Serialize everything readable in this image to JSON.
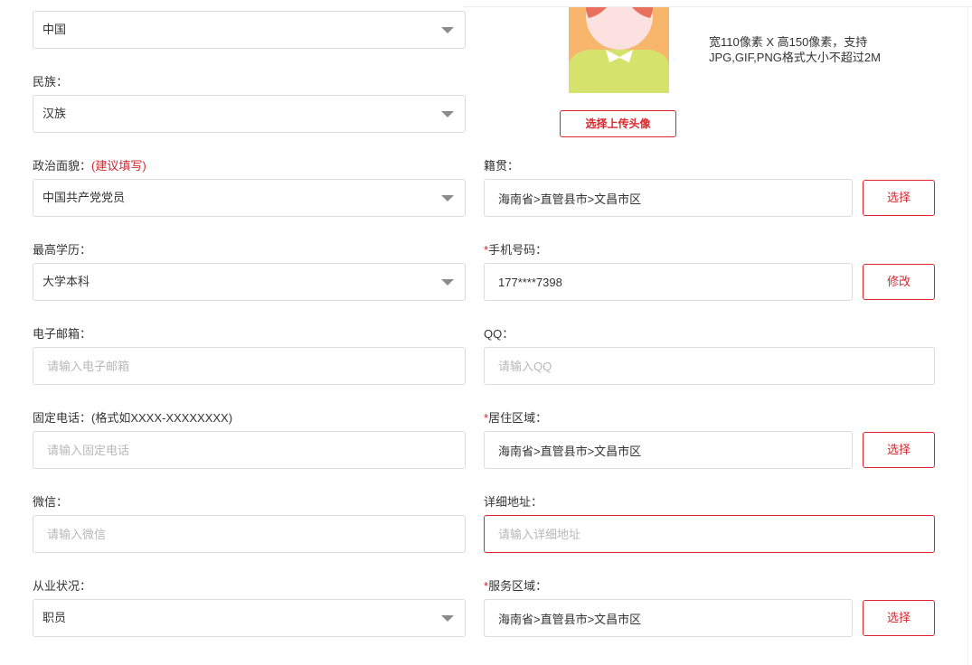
{
  "colors": {
    "accent": "#d9262c",
    "border": "#dcdcdc",
    "text": "#333333",
    "placeholder": "#b8b8b8"
  },
  "country": {
    "value": "中国"
  },
  "ethnicity": {
    "label": "民族：",
    "value": "汉族"
  },
  "political_status": {
    "label": "政治面貌：",
    "hint": "(建议填写)",
    "value": "中国共产党党员"
  },
  "education": {
    "label": "最高学历：",
    "value": "大学本科"
  },
  "email": {
    "label": "电子邮箱：",
    "placeholder": "请输入电子邮箱"
  },
  "landline": {
    "label": "固定电话：(格式如XXXX-XXXXXXXX)",
    "placeholder": "请输入固定电话"
  },
  "wechat": {
    "label": "微信：",
    "placeholder": "请输入微信"
  },
  "employment": {
    "label": "从业状况：",
    "value": "职员"
  },
  "avatar": {
    "hint_line1": "宽110像素 X 高150像素，支持",
    "hint_line2": "JPG,GIF,PNG格式大小不超过2M",
    "upload_button": "选择上传头像"
  },
  "native_place": {
    "label": "籍贯：",
    "value": "海南省>直管县市>文昌市区",
    "button": "选择"
  },
  "mobile": {
    "required_mark": "*",
    "label": "手机号码：",
    "value": "177****7398",
    "button": "修改"
  },
  "qq": {
    "label": "QQ：",
    "placeholder": "请输入QQ"
  },
  "residence_area": {
    "required_mark": "*",
    "label": "居住区域：",
    "value": "海南省>直管县市>文昌市区",
    "button": "选择"
  },
  "address": {
    "label": "详细地址：",
    "placeholder": "请输入详细地址"
  },
  "service_area": {
    "required_mark": "*",
    "label": "服务区域：",
    "value": "海南省>直管县市>文昌市区",
    "button": "选择"
  }
}
